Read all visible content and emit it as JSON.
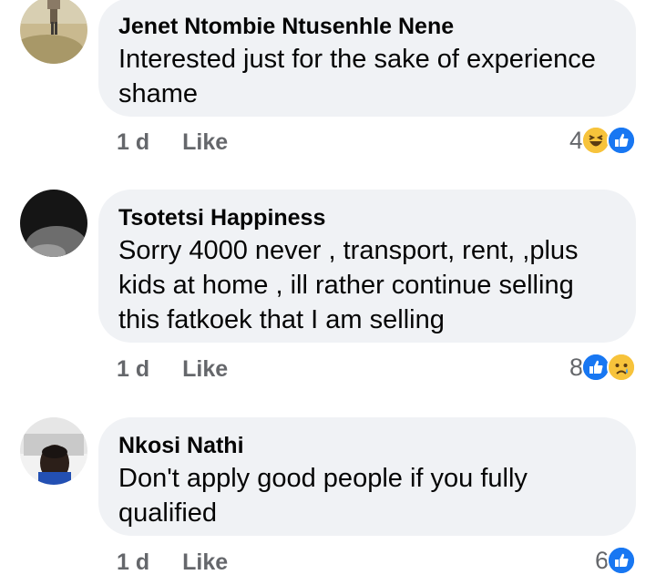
{
  "comments": [
    {
      "author": "Jenet Ntombie Ntusenhle Nene",
      "lines": [
        "Interested just for the sake of experience",
        "shame"
      ],
      "time": "1 d",
      "like_label": "Like",
      "reaction_count": "4",
      "reaction_icons": [
        "haha-icon",
        "like-icon"
      ]
    },
    {
      "author": "Tsotetsi Happiness",
      "lines": [
        "Sorry 4000 never , transport, rent, ,plus",
        "kids at home , ill rather continue selling",
        "this fatkoek that I am selling"
      ],
      "time": "1 d",
      "like_label": "Like",
      "reaction_count": "8",
      "reaction_icons": [
        "like-icon",
        "sad-icon"
      ]
    },
    {
      "author": "Nkosi Nathi",
      "lines": [
        "Don't apply good people if you fully",
        "qualified"
      ],
      "time": "1 d",
      "like_label": "Like",
      "reaction_count": "6",
      "reaction_icons": [
        "like-icon"
      ]
    }
  ],
  "colors": {
    "bubble": "#f0f2f5",
    "meta_text": "#65676b",
    "like_blue": "#1877f2",
    "emoji_yellow": "#f7c33b"
  }
}
